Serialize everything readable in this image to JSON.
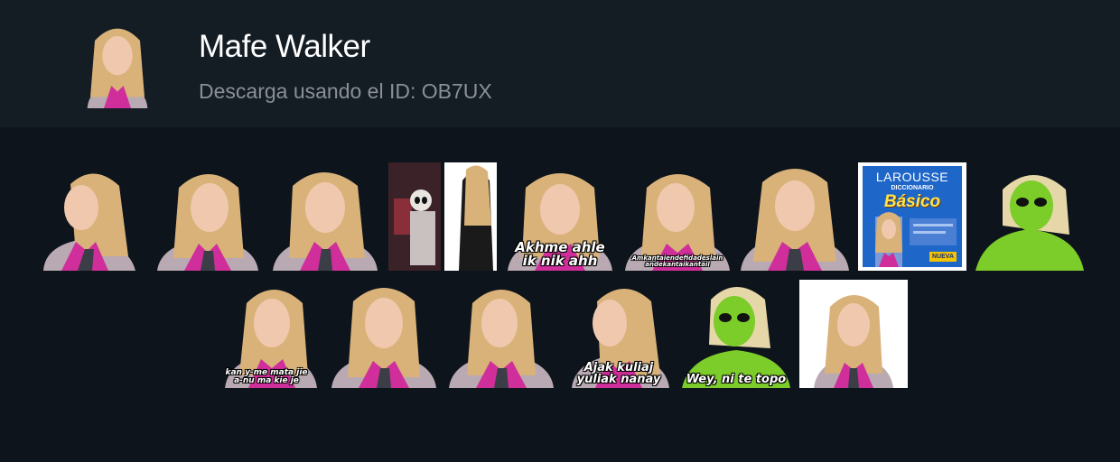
{
  "header": {
    "title": "Mafe Walker",
    "subtitle": "Descarga usando el ID: OB7UX"
  },
  "stickers": [
    {
      "id": "s1",
      "caption": ""
    },
    {
      "id": "s2",
      "caption": ""
    },
    {
      "id": "s3",
      "caption": ""
    },
    {
      "id": "s4",
      "caption": ""
    },
    {
      "id": "s5",
      "caption": "Akhme ahle\nik nik ahh"
    },
    {
      "id": "s6",
      "caption": "Amkantaiendefidadeslain\nandekantaikantail"
    },
    {
      "id": "s7",
      "caption": ""
    },
    {
      "id": "s8",
      "caption": ""
    },
    {
      "id": "s9",
      "caption": ""
    },
    {
      "id": "s10",
      "caption": "kan y-me mata jie\na-nu ma kie je"
    },
    {
      "id": "s11",
      "caption": ""
    },
    {
      "id": "s12",
      "caption": ""
    },
    {
      "id": "s13",
      "caption": "Ajak kuliaj\nyuliak nanay"
    },
    {
      "id": "s14",
      "caption": "Wey, ni te topo"
    },
    {
      "id": "s15",
      "caption": ""
    }
  ],
  "book": {
    "brand": "LAROUSSE",
    "subtitle": "DICCIONARIO",
    "title": "Básico",
    "badge": "NUEVA"
  },
  "colors": {
    "header_bg": "#141c24",
    "page_bg": "#0e141b",
    "scarf": "#d02e9a",
    "hair": "#d9b27a",
    "sweater": "#b9a9b2",
    "alien_green": "#7ccc2a"
  }
}
